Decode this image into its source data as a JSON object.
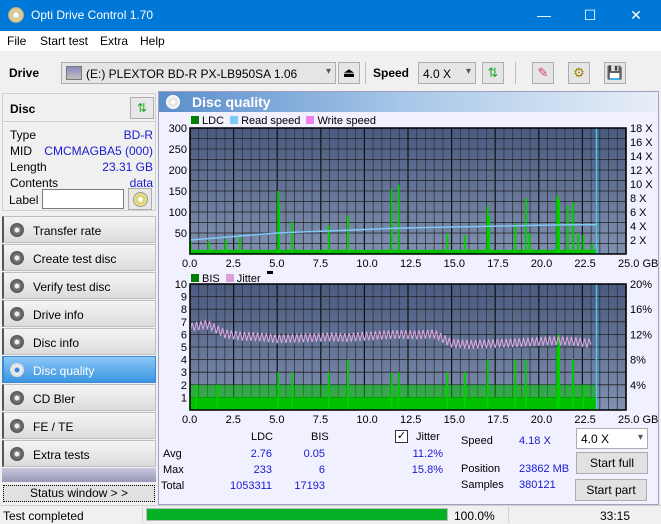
{
  "window": {
    "title": "Opti Drive Control 1.70",
    "minimize": "—",
    "maximize": "☐",
    "close": "✕"
  },
  "menu": [
    "File",
    "Start test",
    "Extra",
    "Help"
  ],
  "toolbar": {
    "drive_label": "Drive",
    "drive_value": "(E:)  PLEXTOR BD-R  PX-LB950SA 1.06",
    "speed_label": "Speed",
    "speed_value": "4.0 X",
    "eject_icon": "⏏",
    "refresh_icon": "⇅",
    "erase_icon": "✎",
    "settings_icon": "⚙",
    "save_icon": "💾"
  },
  "disc": {
    "header": "Disc",
    "fields": [
      {
        "key": "Type",
        "value": "BD-R"
      },
      {
        "key": "MID",
        "value": "CMCMAGBA5 (000)"
      },
      {
        "key": "Length",
        "value": "23.31 GB"
      },
      {
        "key": "Contents",
        "value": "data"
      }
    ],
    "label_key": "Label",
    "label_value": ""
  },
  "nav": [
    {
      "label": "Transfer rate",
      "active": false
    },
    {
      "label": "Create test disc",
      "active": false
    },
    {
      "label": "Verify test disc",
      "active": false
    },
    {
      "label": "Drive info",
      "active": false
    },
    {
      "label": "Disc info",
      "active": false
    },
    {
      "label": "Disc quality",
      "active": true
    },
    {
      "label": "CD Bler",
      "active": false
    },
    {
      "label": "FE / TE",
      "active": false
    },
    {
      "label": "Extra tests",
      "active": false
    }
  ],
  "status_window_button": "Status window > >",
  "panel": {
    "title": "Disc quality"
  },
  "chart_data": [
    {
      "type": "bar",
      "title": "LDC",
      "legend": [
        {
          "name": "LDC",
          "color": "#008000"
        },
        {
          "name": "Read speed",
          "color": "#80c8f8"
        },
        {
          "name": "Write speed",
          "color": "#f080f0"
        }
      ],
      "xlabel": "GB",
      "x_ticks": [
        "0.0",
        "2.5",
        "5.0",
        "7.5",
        "10.0",
        "12.5",
        "15.0",
        "17.5",
        "20.0",
        "22.5",
        "25.0 GB"
      ],
      "xlim": [
        0,
        25
      ],
      "y_ticks": [
        "50",
        "100",
        "150",
        "200",
        "250",
        "300"
      ],
      "ylim": [
        0,
        300
      ],
      "y2_ticks": [
        "2 X",
        "4 X",
        "6 X",
        "8 X",
        "10 X",
        "12 X",
        "14 X",
        "16 X",
        "18 X"
      ],
      "y2lim": [
        0,
        18
      ],
      "end_marker_gb": 23.31,
      "ldc_baseline": 10,
      "ldc_spikes": [
        {
          "x": 0.0,
          "y": 30
        },
        {
          "x": 1.0,
          "y": 30
        },
        {
          "x": 2.0,
          "y": 35
        },
        {
          "x": 2.8,
          "y": 40
        },
        {
          "x": 5.0,
          "y": 150
        },
        {
          "x": 5.05,
          "y": 120
        },
        {
          "x": 5.8,
          "y": 78
        },
        {
          "x": 7.9,
          "y": 68
        },
        {
          "x": 9.0,
          "y": 92
        },
        {
          "x": 11.5,
          "y": 155
        },
        {
          "x": 11.9,
          "y": 165
        },
        {
          "x": 14.7,
          "y": 50
        },
        {
          "x": 15.7,
          "y": 45
        },
        {
          "x": 17.0,
          "y": 113
        },
        {
          "x": 17.1,
          "y": 90
        },
        {
          "x": 18.6,
          "y": 73
        },
        {
          "x": 19.2,
          "y": 133
        },
        {
          "x": 19.4,
          "y": 50
        },
        {
          "x": 21.0,
          "y": 140
        },
        {
          "x": 21.1,
          "y": 130
        },
        {
          "x": 21.6,
          "y": 115
        },
        {
          "x": 21.9,
          "y": 123
        },
        {
          "x": 22.2,
          "y": 50
        },
        {
          "x": 22.5,
          "y": 45
        },
        {
          "x": 23.0,
          "y": 25
        }
      ],
      "read_speed": [
        {
          "x": 0.0,
          "y": 2.0
        },
        {
          "x": 1.0,
          "y": 2.2
        },
        {
          "x": 2.0,
          "y": 2.4
        },
        {
          "x": 3.0,
          "y": 2.6
        },
        {
          "x": 4.0,
          "y": 2.8
        },
        {
          "x": 5.0,
          "y": 3.0
        },
        {
          "x": 6.0,
          "y": 3.1
        },
        {
          "x": 7.0,
          "y": 3.2
        },
        {
          "x": 8.0,
          "y": 3.3
        },
        {
          "x": 9.0,
          "y": 3.4
        },
        {
          "x": 10.0,
          "y": 3.5
        },
        {
          "x": 11.0,
          "y": 3.6
        },
        {
          "x": 12.0,
          "y": 3.7
        },
        {
          "x": 13.0,
          "y": 3.75
        },
        {
          "x": 14.0,
          "y": 3.8
        },
        {
          "x": 15.0,
          "y": 3.85
        },
        {
          "x": 16.0,
          "y": 3.9
        },
        {
          "x": 17.0,
          "y": 3.95
        },
        {
          "x": 18.0,
          "y": 4.0
        },
        {
          "x": 19.0,
          "y": 4.05
        },
        {
          "x": 20.0,
          "y": 4.1
        },
        {
          "x": 21.0,
          "y": 4.15
        },
        {
          "x": 22.0,
          "y": 4.18
        },
        {
          "x": 23.31,
          "y": 4.18
        }
      ]
    },
    {
      "type": "bar",
      "title": "BIS",
      "legend": [
        {
          "name": "BIS",
          "color": "#008000"
        },
        {
          "name": "Jitter",
          "color": "#d8a0d8"
        }
      ],
      "xlabel": "GB",
      "x_ticks": [
        "0.0",
        "2.5",
        "5.0",
        "7.5",
        "10.0",
        "12.5",
        "15.0",
        "17.5",
        "20.0",
        "22.5",
        "25.0 GB"
      ],
      "xlim": [
        0,
        25
      ],
      "y_ticks": [
        "1",
        "2",
        "3",
        "4",
        "5",
        "6",
        "7",
        "8",
        "9",
        "10"
      ],
      "ylim": [
        0,
        10
      ],
      "y2_ticks": [
        "4%",
        "8%",
        "12%",
        "16%",
        "20%"
      ],
      "y2lim": [
        0,
        20
      ],
      "end_marker_gb": 23.31,
      "bis_baseline": 1,
      "bis_spikes": [
        {
          "x": 0.3,
          "y": 2
        },
        {
          "x": 1.5,
          "y": 2
        },
        {
          "x": 5.0,
          "y": 3
        },
        {
          "x": 5.8,
          "y": 3
        },
        {
          "x": 7.9,
          "y": 3
        },
        {
          "x": 9.0,
          "y": 4
        },
        {
          "x": 11.5,
          "y": 3
        },
        {
          "x": 11.9,
          "y": 3
        },
        {
          "x": 14.7,
          "y": 3
        },
        {
          "x": 15.7,
          "y": 3
        },
        {
          "x": 17.0,
          "y": 4
        },
        {
          "x": 18.6,
          "y": 4
        },
        {
          "x": 19.2,
          "y": 4
        },
        {
          "x": 21.0,
          "y": 5
        },
        {
          "x": 21.1,
          "y": 6
        },
        {
          "x": 21.9,
          "y": 4
        },
        {
          "x": 22.5,
          "y": 2
        }
      ],
      "jitter_pct": [
        {
          "x": 0.0,
          "y": 13.0
        },
        {
          "x": 1.0,
          "y": 13.5
        },
        {
          "x": 2.0,
          "y": 12.0
        },
        {
          "x": 3.0,
          "y": 11.6
        },
        {
          "x": 4.0,
          "y": 11.5
        },
        {
          "x": 5.0,
          "y": 11.2
        },
        {
          "x": 6.0,
          "y": 11.3
        },
        {
          "x": 7.0,
          "y": 11.4
        },
        {
          "x": 8.0,
          "y": 11.5
        },
        {
          "x": 9.0,
          "y": 11.4
        },
        {
          "x": 10.0,
          "y": 11.6
        },
        {
          "x": 11.0,
          "y": 11.8
        },
        {
          "x": 12.0,
          "y": 11.9
        },
        {
          "x": 13.0,
          "y": 11.8
        },
        {
          "x": 14.0,
          "y": 12.0
        },
        {
          "x": 15.0,
          "y": 10.5
        },
        {
          "x": 16.0,
          "y": 10.3
        },
        {
          "x": 17.0,
          "y": 10.4
        },
        {
          "x": 18.0,
          "y": 10.5
        },
        {
          "x": 19.0,
          "y": 10.6
        },
        {
          "x": 20.0,
          "y": 10.8
        },
        {
          "x": 21.0,
          "y": 10.9
        },
        {
          "x": 22.0,
          "y": 10.8
        },
        {
          "x": 23.0,
          "y": 10.4
        }
      ]
    }
  ],
  "stats": {
    "col_ldc": "LDC",
    "col_bis": "BIS",
    "jitter_label": "Jitter",
    "jitter_checked": true,
    "rows": [
      {
        "label": "Avg",
        "ldc": "2.76",
        "bis": "0.05",
        "jitter": "11.2%"
      },
      {
        "label": "Max",
        "ldc": "233",
        "bis": "6",
        "jitter": "15.8%"
      },
      {
        "label": "Total",
        "ldc": "1053311",
        "bis": "17193",
        "jitter": ""
      }
    ],
    "speed_label": "Speed",
    "speed_value": "4.18 X",
    "position_label": "Position",
    "position_value": "23862 MB",
    "samples_label": "Samples",
    "samples_value": "380121",
    "speed_select": "4.0 X",
    "start_full": "Start full",
    "start_part": "Start part"
  },
  "statusbar": {
    "status": "Test completed",
    "progress": 100.0,
    "progress_text": "100.0%",
    "time": "33:15"
  }
}
